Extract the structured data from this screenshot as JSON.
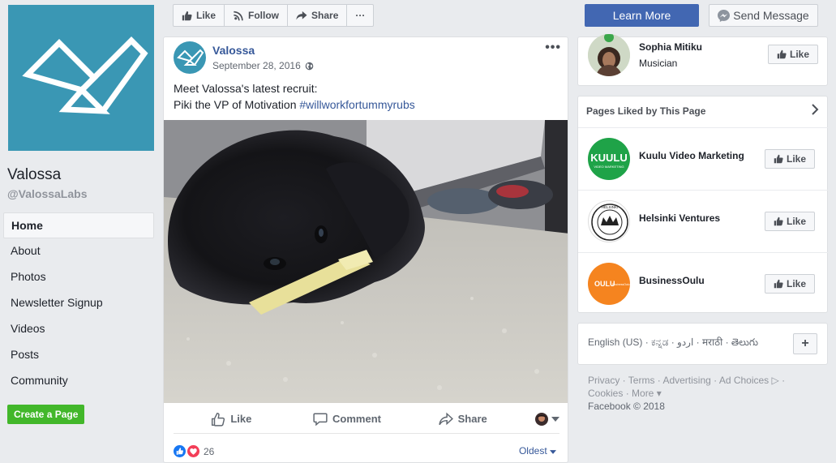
{
  "page": {
    "name": "Valossa",
    "handle": "@ValossaLabs"
  },
  "left_nav": [
    {
      "label": "Home",
      "active": true
    },
    {
      "label": "About"
    },
    {
      "label": "Photos"
    },
    {
      "label": "Newsletter Signup"
    },
    {
      "label": "Videos"
    },
    {
      "label": "Posts"
    },
    {
      "label": "Community"
    }
  ],
  "create_page_label": "Create a Page",
  "top_actions": {
    "like": "Like",
    "follow": "Follow",
    "share": "Share",
    "more": "···"
  },
  "learn_more_label": "Learn More",
  "send_message_label": "Send Message",
  "post": {
    "author": "Valossa",
    "date": "September 28, 2016",
    "options": "•••",
    "text_line1": "Meet Valossa's latest recruit:",
    "text_line2_plain": "Piki the VP of Motivation ",
    "hashtag": "#willworkfortummyrubs",
    "actions": {
      "like": "Like",
      "comment": "Comment",
      "share": "Share"
    },
    "reaction_count": "26",
    "sort_label": "Oldest"
  },
  "member": {
    "name": "Sophia Mitiku",
    "role": "Musician",
    "like_label": "Like"
  },
  "pages_liked": {
    "header": "Pages Liked by This Page",
    "items": [
      {
        "name": "Kuulu Video Marketing",
        "logo_text": "KUULU",
        "logo_sub": "VIDEO MARKETING",
        "like_label": "Like",
        "color": "#1fa348"
      },
      {
        "name": "Helsinki Ventures",
        "logo_text": "HELSINKI",
        "like_label": "Like",
        "color": "#ffffff"
      },
      {
        "name": "BusinessOulu",
        "logo_text": "OULU",
        "logo_sub": "BusinessOulu",
        "like_label": "Like",
        "color": "#f5841f"
      }
    ]
  },
  "languages": {
    "text": "English (US) · ಕನ್ನಡ · اردو · मराठी · తెలుగు",
    "plus": "+"
  },
  "footer": {
    "line1": "Privacy · Terms · Advertising · Ad Choices ▷ ·",
    "line2": "Cookies · More ▾",
    "copyright": "Facebook © 2018"
  }
}
